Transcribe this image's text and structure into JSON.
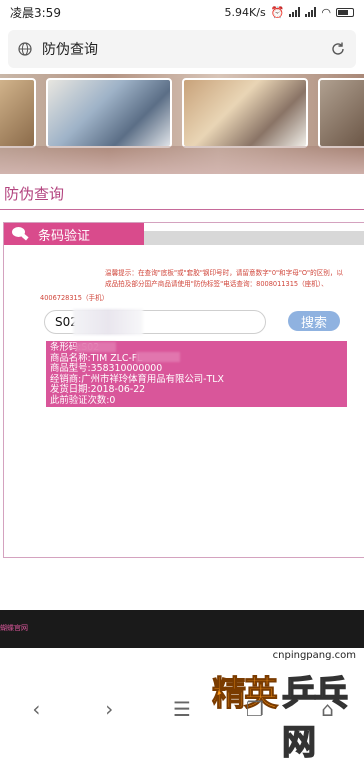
{
  "status": {
    "time": "凌晨3:59",
    "speed": "5.94K/s"
  },
  "browser": {
    "url_title": "防伪查询"
  },
  "page": {
    "title": "防伪查询",
    "tab_label": "条码验证",
    "tip_line1": "温馨提示：在查询\"底板\"或\"套胶\"钢印号时，请留意数字\"0\"和字母\"O\"的区别，以",
    "tip_line2": "成品拍及部分国产商品请使用\"防伪标签\"电话查询：8008011315（座机）、",
    "tip_phone": "4006728315（手机）",
    "search_value": "S02",
    "search_button": "搜索",
    "result": {
      "barcode": "条形码:S02",
      "product_name": "商品名称:TIM        ZLC-FL",
      "model": "商品型号:358310000000",
      "dealer": "经销商:广州市祥玲体育用品有限公司-TLX",
      "ship_date": "发货日期:2018-06-22",
      "verify_count": "此前验证次数:0"
    }
  },
  "footer": {
    "text": "蝴蝶官网"
  },
  "watermark": {
    "url": "cnpingpang.com",
    "big1": "精英",
    "big2": "乒乓网"
  },
  "nav": {
    "back": "‹",
    "forward": "›",
    "menu": "☰",
    "tabs": "❐",
    "home": "⌂"
  }
}
